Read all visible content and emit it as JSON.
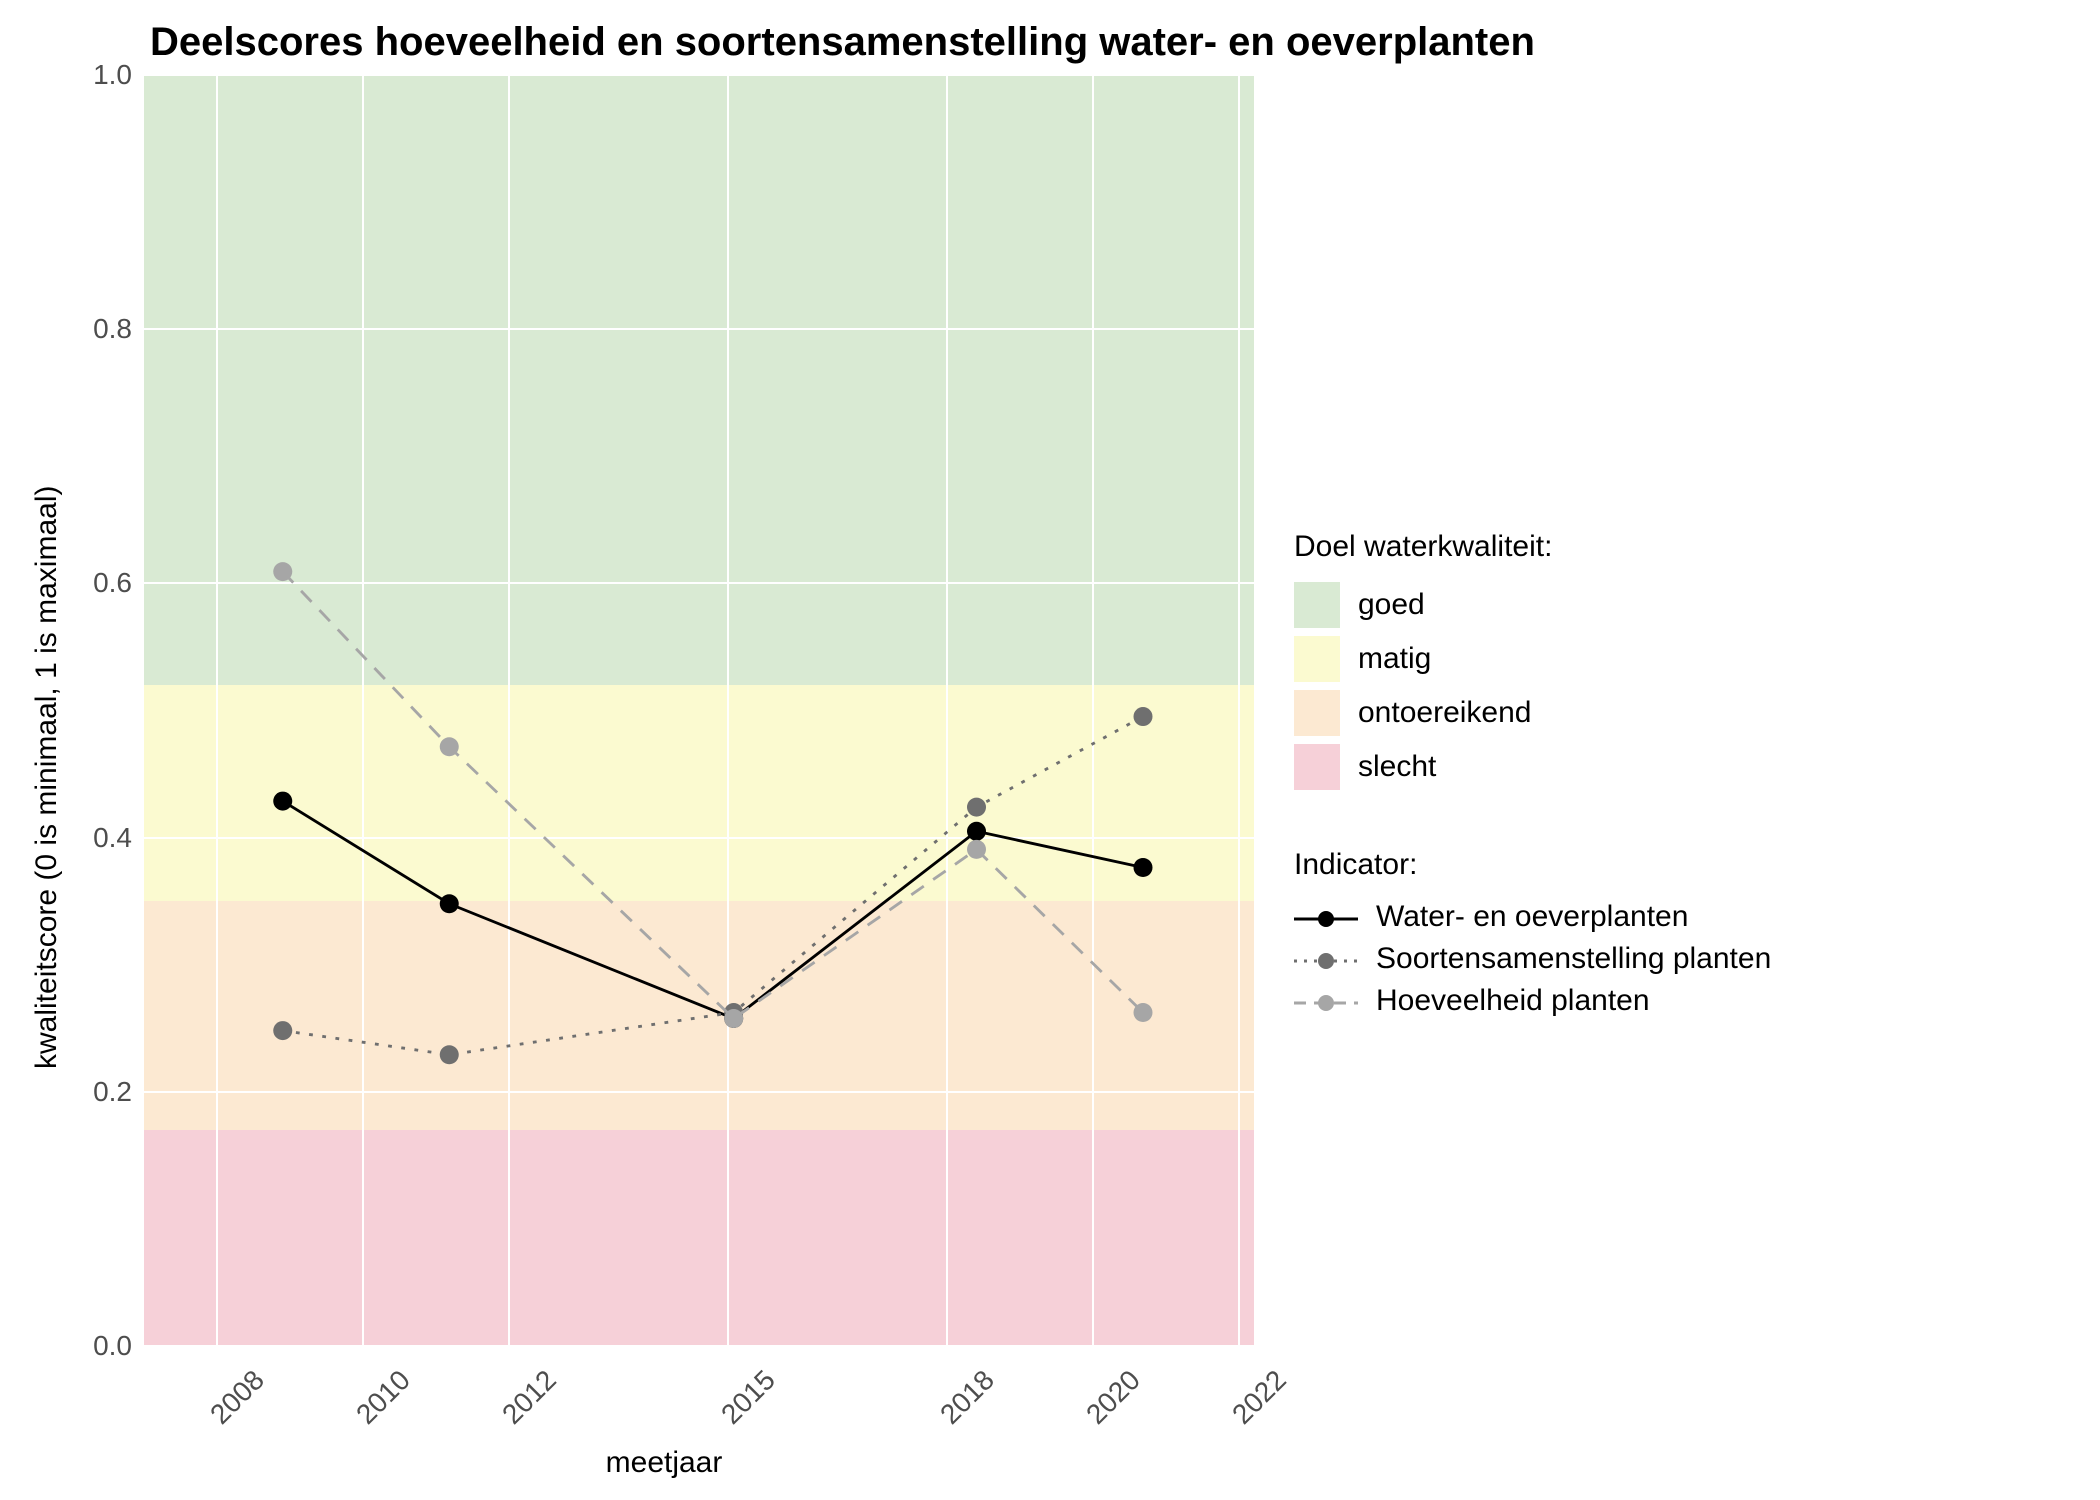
{
  "chart_data": {
    "type": "line",
    "title": "Deelscores hoeveelheid en soortensamenstelling water- en oeverplanten",
    "xlabel": "meetjaar",
    "ylabel": "kwaliteitscore (0 is minimaal, 1 is maximaal)",
    "x_range": [
      2007,
      2023
    ],
    "ylim": [
      0.0,
      1.0
    ],
    "x_ticks": [
      2008,
      2010,
      2012,
      2015,
      2018,
      2020,
      2022
    ],
    "y_ticks": [
      0.0,
      0.2,
      0.4,
      0.6,
      0.8,
      1.0
    ],
    "bands": [
      {
        "name": "goed",
        "from": 0.52,
        "to": 1.0,
        "color": "#d9ead3"
      },
      {
        "name": "matig",
        "from": 0.35,
        "to": 0.52,
        "color": "#fbfad0"
      },
      {
        "name": "ontoereikend",
        "from": 0.17,
        "to": 0.35,
        "color": "#fce9d2"
      },
      {
        "name": "slecht",
        "from": 0.0,
        "to": 0.17,
        "color": "#f6d0d8"
      }
    ],
    "series": [
      {
        "name": "Water- en oeverplanten",
        "style": "solid",
        "point_color": "#000000",
        "line_color": "#000000",
        "x": [
          2009,
          2011.4,
          2015.5,
          2019,
          2021.4
        ],
        "y": [
          0.425,
          0.34,
          0.245,
          0.4,
          0.37
        ]
      },
      {
        "name": "Soortensamenstelling planten",
        "style": "dotted",
        "point_color": "#6f6f6f",
        "line_color": "#6f6f6f",
        "x": [
          2009,
          2011.4,
          2015.5,
          2019,
          2021.4
        ],
        "y": [
          0.235,
          0.215,
          0.25,
          0.42,
          0.495
        ]
      },
      {
        "name": "Hoeveelheid planten",
        "style": "dashed",
        "point_color": "#a6a6a6",
        "line_color": "#a6a6a6",
        "x": [
          2009,
          2011.4,
          2015.5,
          2019,
          2021.4
        ],
        "y": [
          0.615,
          0.47,
          0.245,
          0.385,
          0.25
        ]
      }
    ],
    "legend_bands_title": "Doel waterkwaliteit:",
    "legend_series_title": "Indicator:"
  }
}
